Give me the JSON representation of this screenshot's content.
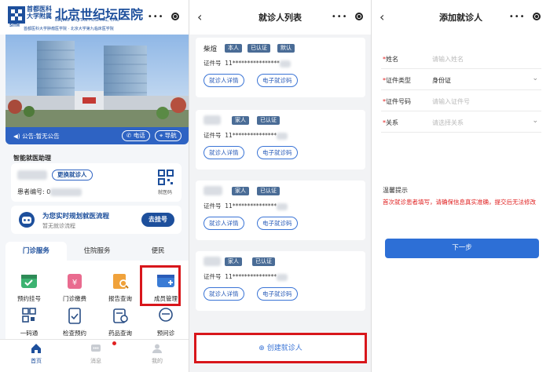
{
  "left": {
    "hospital": {
      "logo_cn_line1": "首都医科",
      "logo_cn_line2": "大学附属",
      "logo_year": "5ITH",
      "name": "北京世纪坛医院",
      "name_en": "BEIJING SHIJITAN HOSPITAL, CMU",
      "subtitle": "首都医科大学肿瘤医学院 · 北京大学第九临床医学院"
    },
    "notice": {
      "text": "公告:暂无公告",
      "phone_label": "电话",
      "nav_label": "导航"
    },
    "assistant": {
      "title": "智能就医助理",
      "switch_label": "更换就诊人",
      "patient_id_label": "患者编号:",
      "patient_id_visible": "0",
      "qr_label": "就医码"
    },
    "plan": {
      "title": "为您实时规划就医流程",
      "subtitle": "暂无就诊流程",
      "button": "去挂号"
    },
    "tabs": [
      "门诊服务",
      "住院服务",
      "便民"
    ],
    "services_row1": [
      {
        "label": "预约挂号",
        "icon": "calendar-icon",
        "color": "#3cb371"
      },
      {
        "label": "门诊缴费",
        "icon": "wallet-icon",
        "color": "#e96b8f"
      },
      {
        "label": "报告查询",
        "icon": "report-search-icon",
        "color": "#f0a23b"
      },
      {
        "label": "成员管理",
        "icon": "member-card-icon",
        "color": "#3a7bd5"
      }
    ],
    "services_row2": [
      {
        "label": "一码通",
        "icon": "qrcode-icon"
      },
      {
        "label": "检查预约",
        "icon": "clipboard-icon"
      },
      {
        "label": "药品查询",
        "icon": "medicine-icon"
      },
      {
        "label": "预问诊",
        "icon": "doctor-icon"
      }
    ],
    "bottom_nav": [
      {
        "label": "首页",
        "icon": "home-icon",
        "active": true
      },
      {
        "label": "消息",
        "icon": "message-icon",
        "active": false
      },
      {
        "label": "我的",
        "icon": "profile-icon",
        "active": false
      }
    ]
  },
  "middle": {
    "title": "就诊人列表",
    "patients": [
      {
        "name": "柴煊",
        "tags": [
          "本人",
          "已认证",
          "默认"
        ],
        "id_label": "证件号",
        "id_value": "11****************"
      },
      {
        "name": "",
        "tags": [
          "家人",
          "已认证"
        ],
        "id_label": "证件号",
        "id_value": "11***************"
      },
      {
        "name": "",
        "tags": [
          "家人",
          "已认证"
        ],
        "id_label": "证件号",
        "id_value": "11***************"
      },
      {
        "name": "",
        "tags": [
          "家人",
          "已认证"
        ],
        "id_label": "证件号",
        "id_value": "11***************"
      }
    ],
    "detail_button": "就诊人详情",
    "ecode_button": "电子就诊码",
    "create_button": "创建就诊人"
  },
  "right": {
    "title": "添加就诊人",
    "fields": [
      {
        "label": "姓名",
        "value": "",
        "placeholder": "请输入姓名",
        "has_dropdown": false
      },
      {
        "label": "证件类型",
        "value": "身份证",
        "placeholder": "",
        "has_dropdown": true
      },
      {
        "label": "证件号码",
        "value": "",
        "placeholder": "请输入证件号",
        "has_dropdown": false
      },
      {
        "label": "关系",
        "value": "",
        "placeholder": "请选择关系",
        "has_dropdown": true
      }
    ],
    "tip_title": "温馨提示",
    "tip_text": "首次就诊患者填写，请确保信息真实准确，提交后无法修改",
    "next_button": "下一步"
  },
  "colors": {
    "brand_blue": "#1d4f9c",
    "primary_button": "#2d6fd6",
    "highlight_red": "#d8161b",
    "tag_bg": "#4a6c96",
    "warning_red": "#e02020"
  }
}
